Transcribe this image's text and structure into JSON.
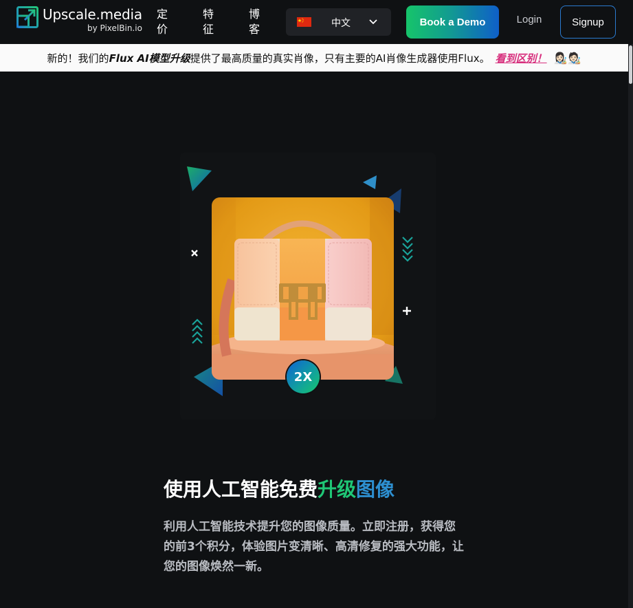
{
  "header": {
    "brand": "Upscale.media",
    "brand_sub": "by PixelBin.io",
    "nav": [
      {
        "label": "定价"
      },
      {
        "label": "特征"
      },
      {
        "label": "博客"
      }
    ],
    "language": {
      "flag": "china-flag-icon",
      "label": "中文"
    },
    "book_demo_label": "Book a Demo",
    "login_label": "Login",
    "signup_label": "Signup"
  },
  "banner": {
    "prefix": "新的！我们的",
    "highlight": "Flux AI模型升级",
    "body": "提供了最高质量的真实肖像，只有主要的AI肖像生成器使用Flux。",
    "link_label": "看到区别！",
    "emoji": "👩🏻‍🎨🧑🏻‍🎨"
  },
  "hero": {
    "badge_label": "2X",
    "title_part1": "使用人工智能免费",
    "title_part2": "升级",
    "title_part3": "图像",
    "subtitle": "利用人工智能技术提升您的图像质量。立即注册，获得您的前3个积分，体验图片变清晰、高清修复的强大功能，让您的图像焕然一新。"
  },
  "colors": {
    "background": "#0f1113",
    "accent_green": "#1fc776",
    "accent_blue": "#2d8fd0",
    "banner_link": "#d72f7d"
  }
}
